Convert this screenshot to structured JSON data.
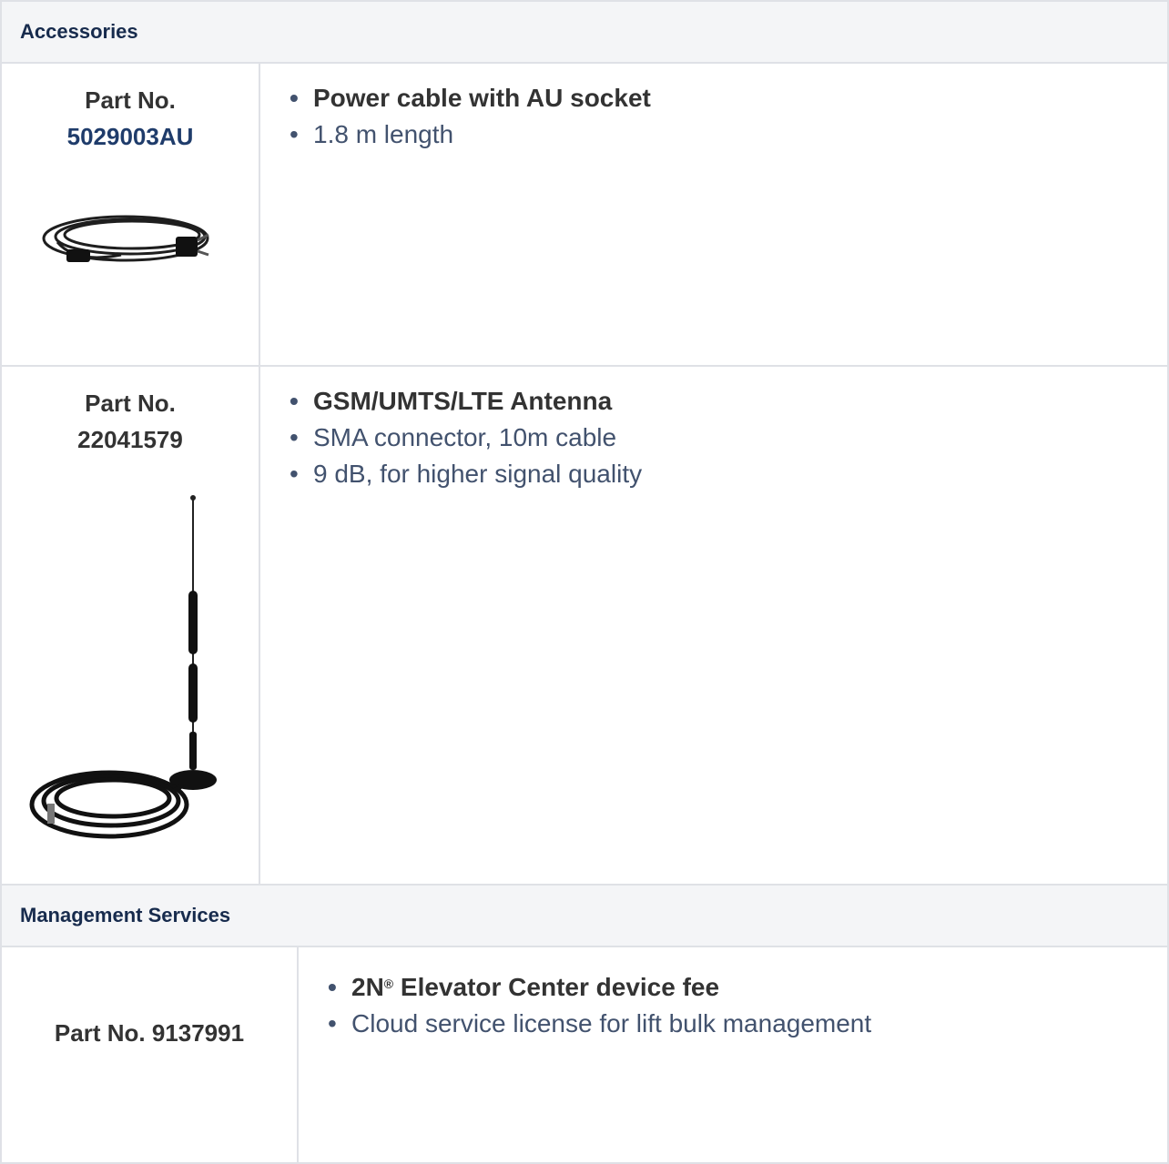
{
  "accessories": {
    "header": "Accessories",
    "items": [
      {
        "part_label": "Part No.",
        "part_no": "5029003AU",
        "image_icon": "power-cable-au-plug",
        "title": "Power cable with AU socket",
        "details": [
          "1.8 m length"
        ]
      },
      {
        "part_label": "Part No.",
        "part_no": "22041579",
        "image_icon": "magnetic-antenna-with-cable",
        "title": "GSM/UMTS/LTE Antenna",
        "details": [
          "SMA connector, 10m cable",
          "9 dB, for higher signal quality"
        ]
      }
    ]
  },
  "management": {
    "header": "Management Services",
    "items": [
      {
        "part": "Part No. 9137991",
        "title_brand": "2N",
        "title_mark": "®",
        "title_rest": " Elevator Center device fee",
        "details": [
          "Cloud service license for lift bulk management"
        ]
      }
    ]
  },
  "colors": {
    "header_bg": "#f4f5f7",
    "border": "#dfe1e6",
    "link": "#1f3c6b",
    "text": "#333333"
  }
}
